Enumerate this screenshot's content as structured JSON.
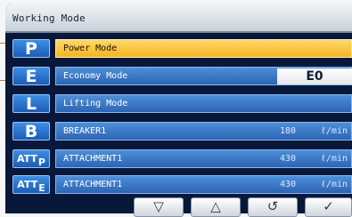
{
  "title": "Working Mode",
  "modes": [
    {
      "key": "P",
      "label": "Power Mode",
      "selected": true
    },
    {
      "key": "E",
      "label": "Economy Mode",
      "value": "E0"
    },
    {
      "key": "L",
      "label": "Lifting Mode"
    },
    {
      "key": "B",
      "label": "BREAKER1",
      "value": "180",
      "unit": "ℓ/min"
    },
    {
      "key": "ATT",
      "key_sub": "P",
      "label": "ATTACHMENT1",
      "value": "430",
      "unit": "ℓ/min"
    },
    {
      "key": "ATT",
      "key_sub": "E",
      "label": "ATTACHMENT1",
      "value": "430",
      "unit": "ℓ/min"
    }
  ],
  "buttons": [
    "▽",
    "△",
    "↺",
    "✓"
  ],
  "colors": {
    "selected": "#f4b323",
    "row": "#2c64b3",
    "key": "#1c5db6",
    "pointer": "#d17e13",
    "background": "#07183a"
  }
}
